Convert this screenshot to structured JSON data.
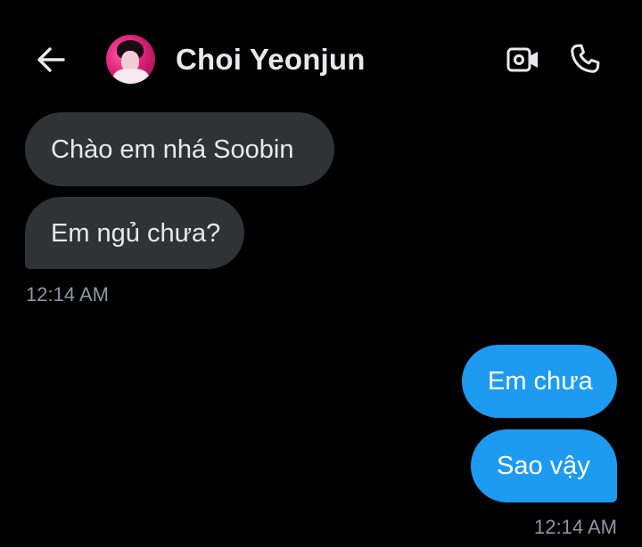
{
  "header": {
    "contact_name": "Choi Yeonjun",
    "back_icon": "arrow-left-icon",
    "video_icon": "video-camera-icon",
    "call_icon": "phone-icon"
  },
  "messages": [
    {
      "direction": "incoming",
      "text": "Chào em nhá Soobin"
    },
    {
      "direction": "incoming",
      "text": "Em ngủ chưa?"
    },
    {
      "direction": "outgoing",
      "text": "Em chưa"
    },
    {
      "direction": "outgoing",
      "text": "Sao vậy"
    }
  ],
  "timestamps": {
    "incoming_group": "12:14 AM",
    "outgoing_group": "12:14 AM"
  },
  "colors": {
    "background": "#000000",
    "incoming_bubble": "#2f3336",
    "outgoing_bubble": "#1d9bf0",
    "timestamp": "#8b98a5",
    "text": "#e7e9ea"
  }
}
